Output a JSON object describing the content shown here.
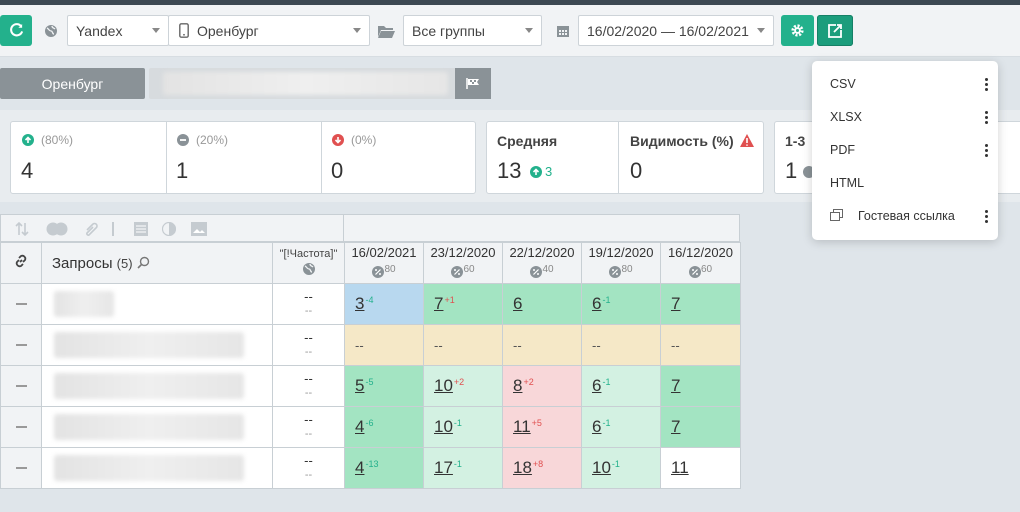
{
  "colors": {
    "accent": "#23b18c",
    "up": "#23b18c",
    "down": "#e05050",
    "green_cell": "#a3e4c2",
    "light_green_cell": "#d3f1e2",
    "blue_cell": "#b8d8ef",
    "beige_cell": "#f5e8c7",
    "pink_cell": "#f8d7d9"
  },
  "toolbar": {
    "refresh_icon": "refresh-icon",
    "search_engine": "Yandex",
    "region": "Оренбург",
    "group": "Все группы",
    "date_range": "16/02/2020 — 16/02/2021"
  },
  "region_tab": {
    "label": "Оренбург"
  },
  "kpi": {
    "up": {
      "pct": "(80%)",
      "value": "4"
    },
    "same": {
      "pct": "(20%)",
      "value": "1"
    },
    "down": {
      "pct": "(0%)",
      "value": "0"
    },
    "avg": {
      "title": "Средняя",
      "value": "13",
      "delta": "3"
    },
    "visibility": {
      "title": "Видимость (%)",
      "value": "0"
    },
    "top3": {
      "title": "1-3",
      "value": "1"
    }
  },
  "table": {
    "queries_label": "Запросы",
    "queries_count": "(5)",
    "freq_label": "\"[!Частота]\"",
    "dates": [
      {
        "date": "16/02/2021",
        "pct": "80"
      },
      {
        "date": "23/12/2020",
        "pct": "60"
      },
      {
        "date": "22/12/2020",
        "pct": "40"
      },
      {
        "date": "19/12/2020",
        "pct": "80"
      },
      {
        "date": "16/12/2020",
        "pct": "60"
      }
    ],
    "rows": [
      {
        "freq": "--",
        "freq2": "--",
        "cells": [
          {
            "v": "3",
            "d": "-4",
            "dir": "up"
          },
          {
            "v": "7",
            "d": "+1",
            "dir": "down"
          },
          {
            "v": "6",
            "d": "",
            "dir": ""
          },
          {
            "v": "6",
            "d": "-1",
            "dir": "up"
          },
          {
            "v": "7",
            "d": "",
            "dir": ""
          }
        ]
      },
      {
        "freq": "--",
        "freq2": "--",
        "cells": [
          {
            "v": "--",
            "d": "",
            "dir": ""
          },
          {
            "v": "--",
            "d": "",
            "dir": ""
          },
          {
            "v": "--",
            "d": "",
            "dir": ""
          },
          {
            "v": "--",
            "d": "",
            "dir": ""
          },
          {
            "v": "--",
            "d": "",
            "dir": ""
          }
        ]
      },
      {
        "freq": "--",
        "freq2": "--",
        "cells": [
          {
            "v": "5",
            "d": "-5",
            "dir": "up"
          },
          {
            "v": "10",
            "d": "+2",
            "dir": "down"
          },
          {
            "v": "8",
            "d": "+2",
            "dir": "down"
          },
          {
            "v": "6",
            "d": "-1",
            "dir": "up"
          },
          {
            "v": "7",
            "d": "",
            "dir": ""
          }
        ]
      },
      {
        "freq": "--",
        "freq2": "--",
        "cells": [
          {
            "v": "4",
            "d": "-6",
            "dir": "up"
          },
          {
            "v": "10",
            "d": "-1",
            "dir": "up"
          },
          {
            "v": "11",
            "d": "+5",
            "dir": "down"
          },
          {
            "v": "6",
            "d": "-1",
            "dir": "up"
          },
          {
            "v": "7",
            "d": "",
            "dir": ""
          }
        ]
      },
      {
        "freq": "--",
        "freq2": "--",
        "cells": [
          {
            "v": "4",
            "d": "-13",
            "dir": "up"
          },
          {
            "v": "17",
            "d": "-1",
            "dir": "up"
          },
          {
            "v": "18",
            "d": "+8",
            "dir": "down"
          },
          {
            "v": "10",
            "d": "-1",
            "dir": "up"
          },
          {
            "v": "11",
            "d": "",
            "dir": ""
          }
        ]
      }
    ]
  },
  "export_menu": {
    "items": [
      "CSV",
      "XLSX",
      "PDF",
      "HTML"
    ],
    "guest_link": "Гостевая ссылка"
  }
}
